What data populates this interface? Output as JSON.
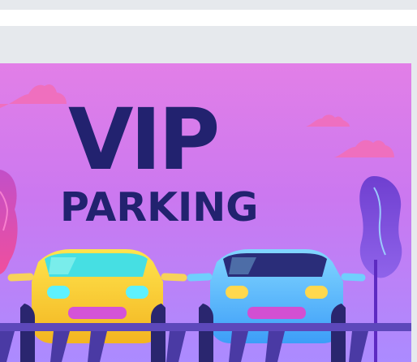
{
  "illustration": {
    "headline": "VIP",
    "subheadline": "PARKING"
  },
  "colors": {
    "gray_background": "#e6e9ed",
    "white_strip": "#ffffff",
    "text_navy": "#22226f",
    "sky_top": "#e27fe7",
    "sky_mid": "#bf78f2",
    "sky_bottom": "#9f87ff",
    "cloud_pink": "#ef6fbe",
    "tree_purple": "#8046d1",
    "tree_magenta": "#e04db5",
    "car_yellow": "#f8cf2f",
    "car_blue": "#57b9ff",
    "rail_purple": "#6144b9"
  },
  "icons": {
    "left_cloud": "cloud-icon",
    "right_cloud": "cloud-icon",
    "left_tree": "tree-icon",
    "right_tree": "tree-icon",
    "left_car": "car-icon",
    "right_car": "car-icon"
  }
}
